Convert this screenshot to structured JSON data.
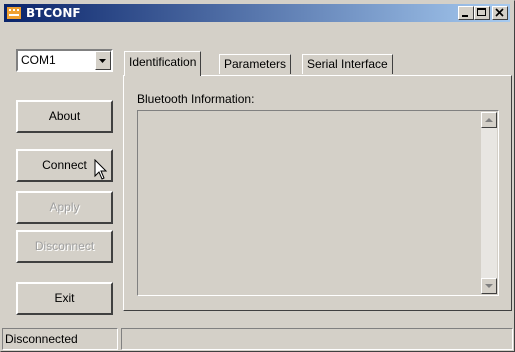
{
  "window": {
    "title": "BTCONF"
  },
  "port_select": {
    "value": "COM1"
  },
  "buttons": {
    "about": "About",
    "connect": "Connect",
    "apply": "Apply",
    "disconnect": "Disconnect",
    "exit": "Exit"
  },
  "tabs": [
    {
      "label": "Identification",
      "active": true
    },
    {
      "label": "Parameters",
      "active": false
    },
    {
      "label": "Serial Interface",
      "active": false
    }
  ],
  "identification": {
    "group_label": "Bluetooth Information:",
    "info_text": ""
  },
  "status_bar": {
    "connection": "Disconnected",
    "message": ""
  },
  "colors": {
    "titlebar_start": "#0a246a",
    "titlebar_end": "#a6caf0",
    "face": "#d4d0c8"
  },
  "icons": [
    "app-icon",
    "minimize-icon",
    "maximize-icon",
    "close-icon",
    "dropdown-arrow-icon",
    "scroll-up-icon",
    "scroll-down-icon",
    "mouse-pointer-icon"
  ]
}
